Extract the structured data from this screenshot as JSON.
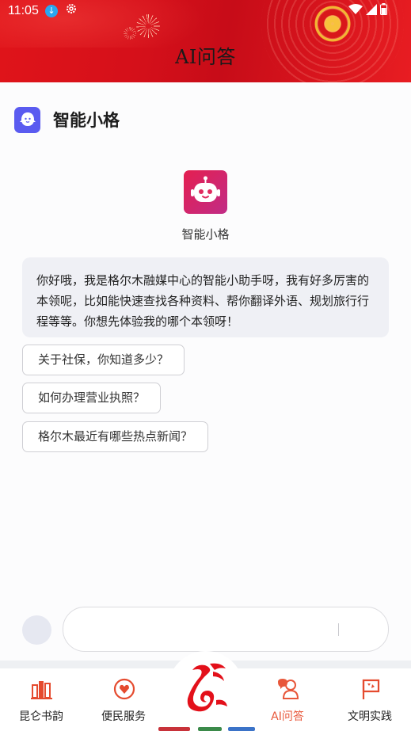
{
  "status_bar": {
    "time": "11:05",
    "download_icon": "download-arrow-icon",
    "settings_icon": "gear-icon",
    "wifi_icon": "wifi-icon",
    "signal_icon": "signal-icon",
    "battery_icon": "battery-icon"
  },
  "header": {
    "title": "AI问答",
    "theme_color": "#d5101a"
  },
  "assistant": {
    "title": "智能小格",
    "name": "智能小格",
    "greeting": "你好哦，我是格尔木融媒中心的智能小助手呀，我有好多厉害的本领呢，比如能快速查找各种资料、帮你翻译外语、规划旅行行程等等。你想先体验我的哪个本领呀！",
    "title_icon_color": "#5a5bf0"
  },
  "suggestions": [
    "关于社保，你知道多少？",
    "如何办理营业执照？",
    "格尔木最近有哪些热点新闻？"
  ],
  "input": {
    "value": "",
    "placeholder": ""
  },
  "nav": {
    "items": [
      {
        "label": "昆仑书韵",
        "icon": "books-icon",
        "active": false
      },
      {
        "label": "便民服务",
        "icon": "heart-hands-icon",
        "active": false
      },
      {
        "label": "",
        "icon": "center-logo-icon",
        "active": false
      },
      {
        "label": "AI问答",
        "icon": "ai-chat-icon",
        "active": true
      },
      {
        "label": "文明实践",
        "icon": "flag-icon",
        "active": false
      }
    ],
    "accent_color": "#e8573a"
  }
}
